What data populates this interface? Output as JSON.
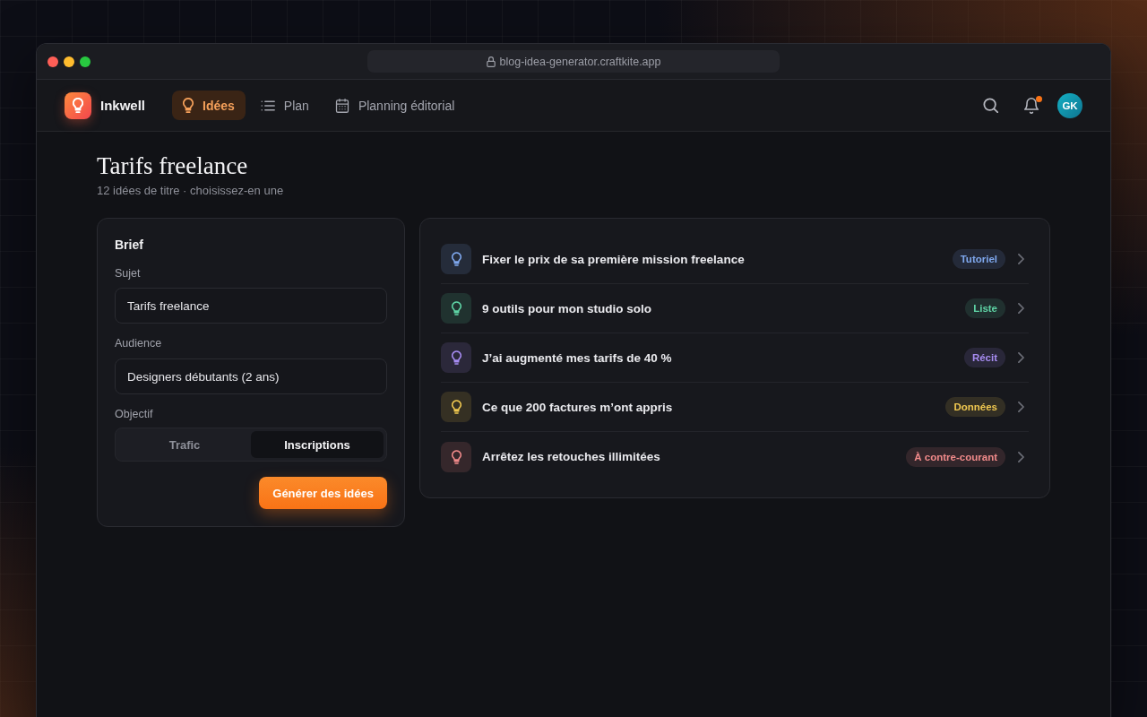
{
  "browser": {
    "url": "blog-idea-generator.craftkite.app"
  },
  "app": {
    "name": "Inkwell"
  },
  "nav": [
    {
      "label": "Idées",
      "selected": true
    },
    {
      "label": "Plan",
      "selected": false
    },
    {
      "label": "Planning éditorial",
      "selected": false
    }
  ],
  "header_actions": {
    "notifications_unread": true,
    "avatar_initials": "GK"
  },
  "page": {
    "title": "Tarifs freelance",
    "subtitle": "12 idées de titre · choisissez-en une"
  },
  "brief": {
    "title": "Brief",
    "fields": [
      {
        "label": "Sujet",
        "value": "Tarifs freelance"
      },
      {
        "label": "Audience",
        "value": "Designers débutants (2 ans)"
      }
    ],
    "objective": {
      "label": "Objectif",
      "options": [
        {
          "label": "Trafic",
          "selected": false
        },
        {
          "label": "Inscriptions",
          "selected": true
        }
      ]
    },
    "button": "Générer des idées"
  },
  "ideas": [
    {
      "title": "Fixer le prix de sa première mission freelance",
      "tag": "Tutoriel",
      "color": "#7fa8ee"
    },
    {
      "title": "9 outils pour mon studio solo",
      "tag": "Liste",
      "color": "#5fd4a5"
    },
    {
      "title": "J’ai augmenté mes tarifs de 40 %",
      "tag": "Récit",
      "color": "#a78cf2"
    },
    {
      "title": "Ce que 200 factures m’ont appris",
      "tag": "Données",
      "color": "#f0c850"
    },
    {
      "title": "Arrêtez les retouches illimitées",
      "tag": "À contre-courant",
      "color": "#f08a8a"
    }
  ]
}
